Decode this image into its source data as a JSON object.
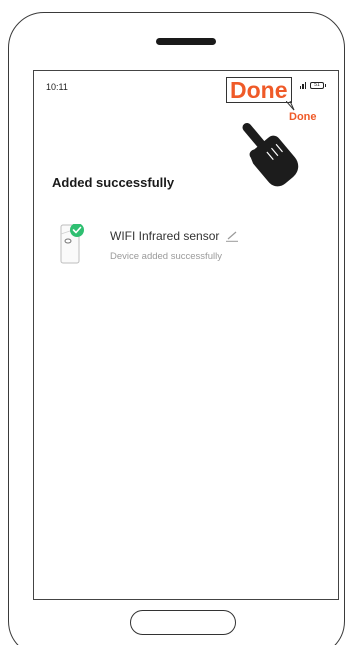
{
  "status_bar": {
    "time": "10:11",
    "battery": "51"
  },
  "callout": {
    "label": "Done"
  },
  "header": {
    "done_label": "Done"
  },
  "main": {
    "title": "Added successfully",
    "device": {
      "name": "WIFI Infrared sensor",
      "status": "Device added successfully"
    }
  },
  "colors": {
    "accent": "#ef5a28",
    "success": "#2fbf71",
    "text_primary": "#1a1a1a",
    "text_secondary": "#9a9a9a"
  },
  "icons": [
    "signal-icon",
    "battery-icon",
    "hand-pointer-icon",
    "check-badge-icon",
    "edit-pencil-icon"
  ]
}
